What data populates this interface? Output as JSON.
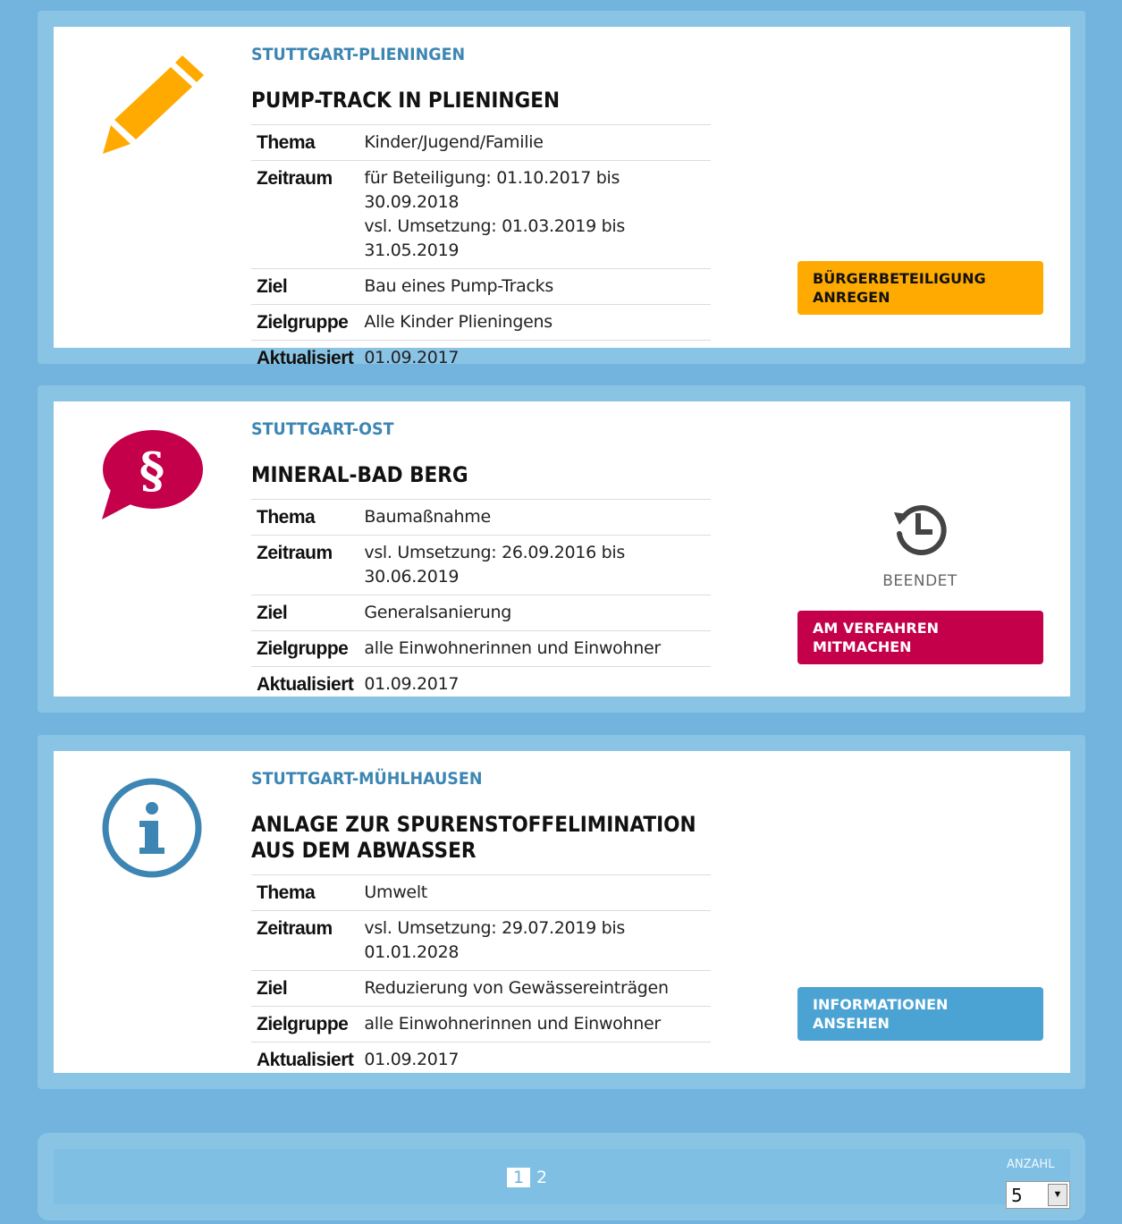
{
  "colors": {
    "background": "#72b4de",
    "district": "#3d86b3",
    "orange": "#ffaa00",
    "red": "#c4004b",
    "blue": "#4ba3d3"
  },
  "cards": [
    {
      "icon": "pencil-icon",
      "district": "STUTTGART-PLIENINGEN",
      "title": "PUMP-TRACK IN PLIENINGEN",
      "rows": [
        {
          "key": "Thema",
          "value": "Kinder/Jugend/Familie"
        },
        {
          "key": "Zeitraum",
          "value": "für Beteiligung: 01.10.2017 bis 30.09.2018",
          "value2": "vsl. Umsetzung: 01.03.2019 bis 31.05.2019"
        },
        {
          "key": "Ziel",
          "value": "Bau eines Pump-Tracks"
        },
        {
          "key": "Zielgruppe",
          "value": "Alle Kinder Plieningens"
        },
        {
          "key": "Aktualisiert",
          "value": "01.09.2017"
        }
      ],
      "button": "BÜRGERBETEILIGUNG ANREGEN"
    },
    {
      "icon": "paragraph-speech-bubble-icon",
      "district": "STUTTGART-OST",
      "title": "MINERAL-BAD BERG",
      "rows": [
        {
          "key": "Thema",
          "value": "Baumaßnahme"
        },
        {
          "key": "Zeitraum",
          "value": "vsl. Umsetzung: 26.09.2016 bis 30.06.2019"
        },
        {
          "key": "Ziel",
          "value": "Generalsanierung"
        },
        {
          "key": "Zielgruppe",
          "value": "alle Einwohnerinnen und Einwohner"
        },
        {
          "key": "Aktualisiert",
          "value": "01.09.2017"
        }
      ],
      "status": "BEENDET",
      "status_icon": "history-clock-icon",
      "button": "AM VERFAHREN MITMACHEN"
    },
    {
      "icon": "info-circle-icon",
      "district": "STUTTGART-MÜHLHAUSEN",
      "title": "ANLAGE ZUR SPURENSTOFFELIMINATION AUS DEM ABWASSER",
      "rows": [
        {
          "key": "Thema",
          "value": "Umwelt"
        },
        {
          "key": "Zeitraum",
          "value": "vsl. Umsetzung: 29.07.2019 bis 01.01.2028"
        },
        {
          "key": "Ziel",
          "value": "Reduzierung von Gewässereinträgen"
        },
        {
          "key": "Zielgruppe",
          "value": "alle Einwohnerinnen und Einwohner"
        },
        {
          "key": "Aktualisiert",
          "value": "01.09.2017"
        }
      ],
      "button": "INFORMATIONEN ANSEHEN"
    }
  ],
  "pagination": {
    "pages": [
      "1",
      "2"
    ],
    "active": "1",
    "anzahl_label": "ANZAHL",
    "anzahl_value": "5"
  }
}
